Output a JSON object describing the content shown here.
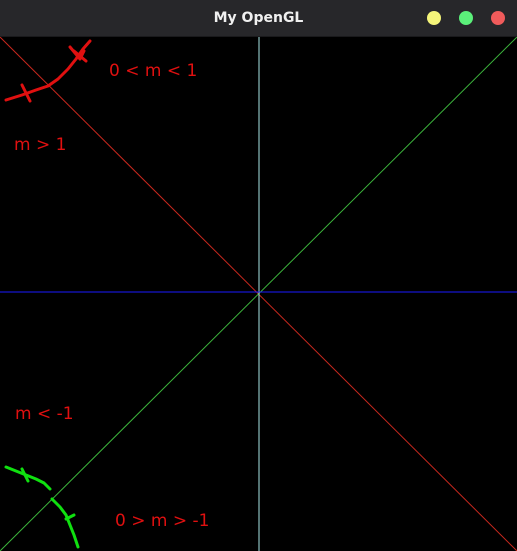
{
  "window": {
    "title": "My OpenGL",
    "titlebar_color": "#27272a",
    "buttons": {
      "minimize_color": "#f5f57a",
      "maximize_color": "#5bf07a",
      "close_color": "#f05b5b"
    }
  },
  "scene": {
    "background": "#000000",
    "lines": {
      "horizontal_axis_color": "#1a1aff",
      "vertical_axis_color": "#a8e6e6",
      "positive_diagonal_color": "#3cb43c",
      "negative_diagonal_color": "#c8281e"
    }
  },
  "annotations": {
    "label_color": "#e01010",
    "marker_red": "#e01010",
    "marker_green": "#10e010",
    "top_right_label": "0 < m < 1",
    "upper_left_label": "m > 1",
    "lower_left_label": "m < -1",
    "bottom_right_label": "0 > m > -1"
  }
}
